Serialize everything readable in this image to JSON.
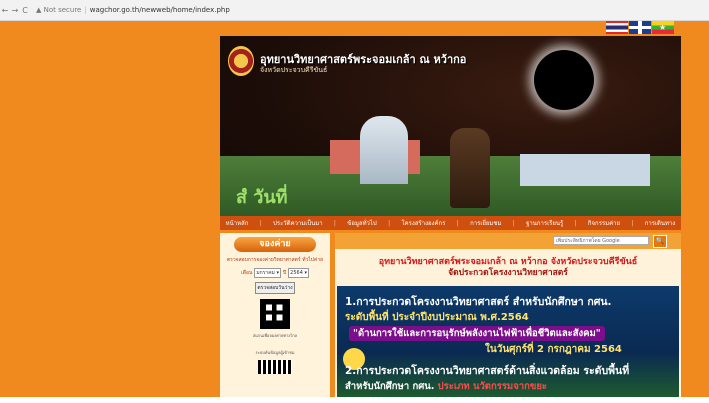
{
  "browser": {
    "back": "←",
    "forward": "→",
    "reload": "C",
    "security": "▲ Not secure",
    "url": "wagchor.go.th/newweb/home/index.php"
  },
  "header": {
    "title": "อุทยานวิทยาศาสตร์พระจอมเกล้า ณ หว้ากอ",
    "subtitle": "จังหวัดประจวบคีรีขันธ์",
    "sign_text": "สํ วันที่"
  },
  "menu": {
    "items": [
      "หน้าหลัก",
      "ประวัติความเป็นมา",
      "ข้อมูลทั่วไป",
      "โครงสร้างองค์กร",
      "การเยี่ยมชม",
      "ฐานการเรียนรู้",
      "กิจกรรมค่าย",
      "การเดินทาง"
    ]
  },
  "booking": {
    "title": "จองค่าย",
    "note": "ตรวจสอบการจองค่ายวิทยาศาสตร์ ทั่วไปค่าย",
    "month_label": "เดือน",
    "month_value": "มกราคม",
    "year_label": "ปี",
    "year_value": "2564",
    "check_button": "ตรวจสอบวันว่าง",
    "qr_caption": "สแกนเพื่อจองค่ายทางไกล",
    "stats_caption": "ระบบค้นข้อมูลผู้เข้าชม"
  },
  "search": {
    "placeholder": "เพิ่มประสิทธิภาพโดย Google",
    "button": "🔍"
  },
  "main": {
    "headline1": "อุทยานวิทยาศาสตร์พระจอมเกล้า ณ หว้ากอ จังหวัดประจวบคีรีขันธ์",
    "headline2": "จัดประกวดโครงงานวิทยาศาสตร์"
  },
  "poster": {
    "line1": "1.การประกวดโครงงานวิทยาศาสตร์ สำหรับนักศึกษา กศน.",
    "line2": "ระดับพื้นที่ ประจำปีงบประมาณ พ.ศ.2564",
    "line3": "\"ด้านการใช้และการอนุรักษ์พลังงานไฟฟ้าเพื่อชีวิตและสังคม\"",
    "line4": "ในวันศุกร์ที่ 2 กรกฎาคม 2564",
    "line5": "2.การประกวดโครงงานวิทยาศาสตร์ด้านสิ่งแวดล้อม ระดับพื้นที่",
    "line6a": "สำหรับนักศึกษา กศน. ",
    "line6b": "ประเภท นวัตกรรมจากขยะ"
  }
}
